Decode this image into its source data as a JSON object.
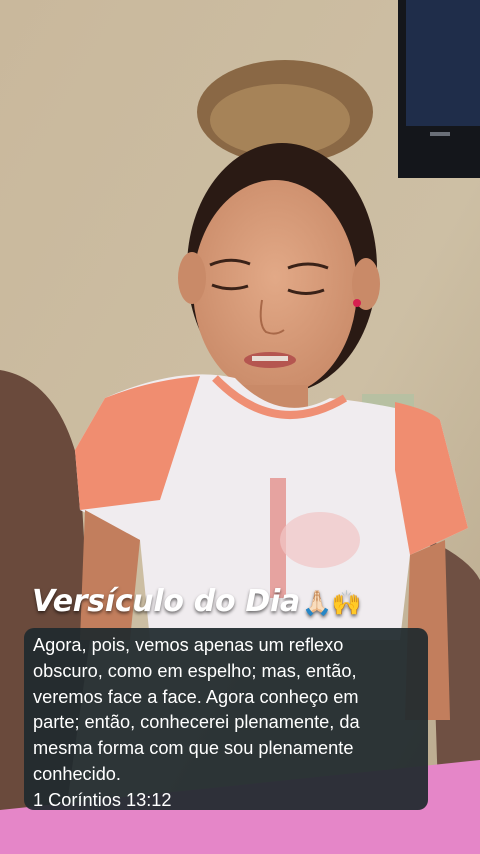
{
  "overlay": {
    "title": "Versículo do Dia",
    "title_emoji": "🙏🏻🙌",
    "verse_lines": [
      "Agora, pois, vemos apenas um reflexo",
      "obscuro, como em espelho; mas, então,",
      "veremos face a face. Agora conheço em",
      "parte; então, conhecerei plenamente, da",
      "mesma forma com que sou plenamente",
      "conhecido.",
      "1 Coríntios 13:12"
    ]
  },
  "photo": {
    "description_icon": "girl-reading-photo"
  }
}
